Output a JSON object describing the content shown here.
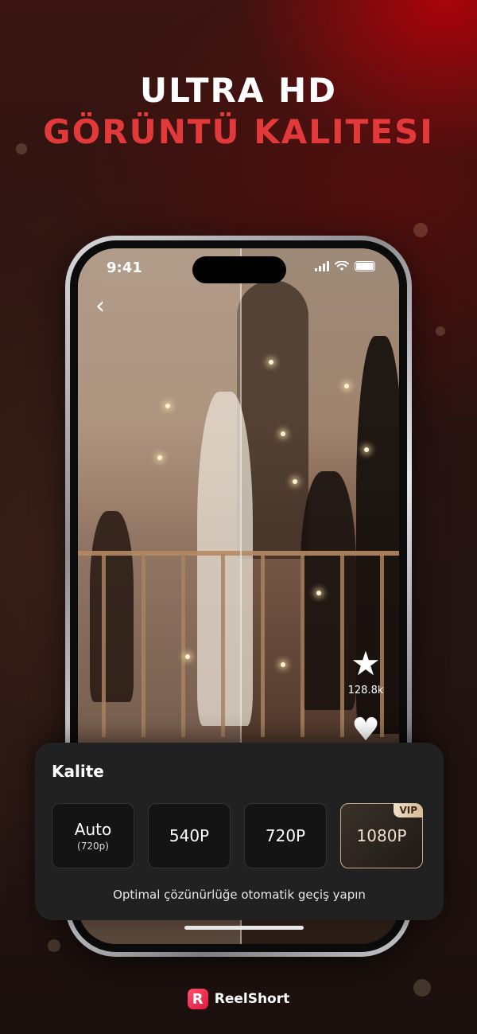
{
  "headline": {
    "line1": "ULTRA HD",
    "line2": "GÖRÜNTÜ KALITESI"
  },
  "status_bar": {
    "time": "9:41"
  },
  "player": {
    "favorite_count": "128.8k",
    "icons": [
      "back-chevron-icon",
      "star-icon",
      "heart-icon"
    ]
  },
  "quality_sheet": {
    "title": "Kalite",
    "options": [
      {
        "label": "Auto",
        "sublabel": "(720p)"
      },
      {
        "label": "540P"
      },
      {
        "label": "720P"
      },
      {
        "label": "1080P",
        "badge": "VIP"
      }
    ],
    "hint": "Optimal çözünürlüğe otomatik geçiş yapın"
  },
  "brand": {
    "logo_letter": "R",
    "name": "ReelShort"
  },
  "colors": {
    "accent_red": "#e23a3a",
    "vip_gold": "#d8bb93",
    "sheet_bg": "#212121"
  }
}
